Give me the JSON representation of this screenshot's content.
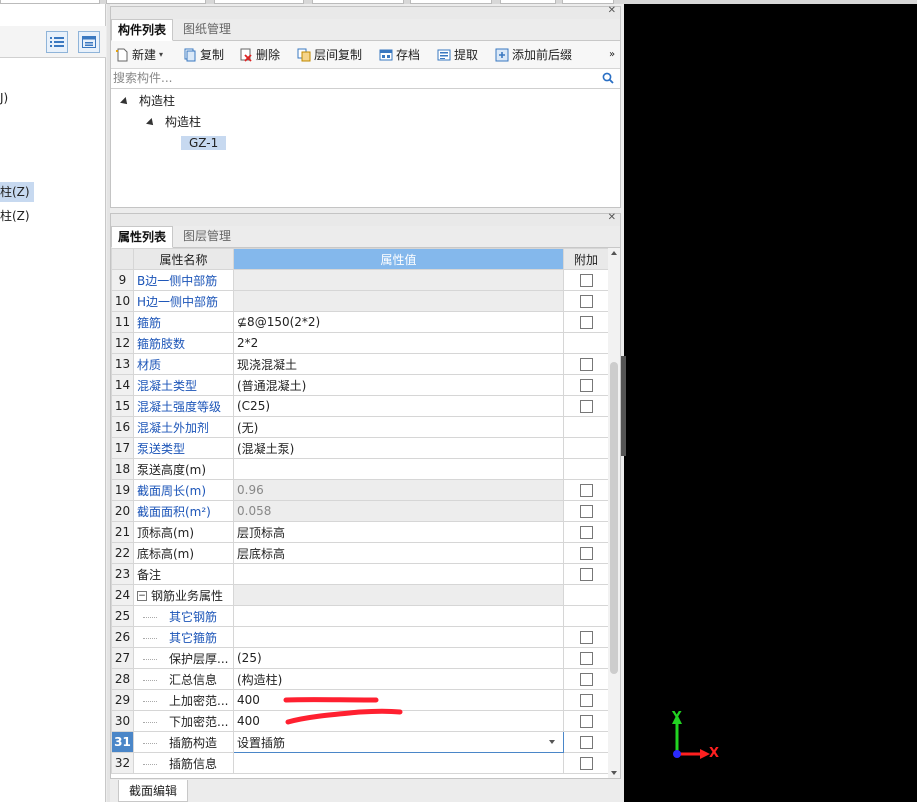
{
  "left": {
    "items": [
      {
        "label": "J)"
      },
      {
        "label": "柱(Z)"
      },
      {
        "label": "柱(Z)"
      }
    ]
  },
  "component_panel": {
    "tabs": [
      {
        "label": "构件列表"
      },
      {
        "label": "图纸管理"
      }
    ],
    "toolbar": {
      "new": "新建",
      "copy": "复制",
      "delete": "删除",
      "floor_copy": "层间复制",
      "save": "存档",
      "extract": "提取",
      "add_prefix": "添加前后缀",
      "more": "»"
    },
    "search": {
      "placeholder": "搜索构件..."
    },
    "tree": {
      "root": "构造柱",
      "child": "构造柱",
      "leaf": "GZ-1"
    }
  },
  "property_panel": {
    "tabs": [
      {
        "label": "属性列表"
      },
      {
        "label": "图层管理"
      }
    ],
    "headers": {
      "name": "属性名称",
      "value": "属性值",
      "add": "附加"
    },
    "rows": [
      {
        "num": "9",
        "name": "B边一侧中部筋",
        "value": ""
      },
      {
        "num": "10",
        "name": "H边一侧中部筋",
        "value": ""
      },
      {
        "num": "11",
        "name": "箍筋",
        "value": "⊈8@150(2*2)"
      },
      {
        "num": "12",
        "name": "箍筋肢数",
        "value": "2*2"
      },
      {
        "num": "13",
        "name": "材质",
        "value": "现浇混凝土"
      },
      {
        "num": "14",
        "name": "混凝土类型",
        "value": "(普通混凝土)"
      },
      {
        "num": "15",
        "name": "混凝土强度等级",
        "value": "(C25)"
      },
      {
        "num": "16",
        "name": "混凝土外加剂",
        "value": "(无)"
      },
      {
        "num": "17",
        "name": "泵送类型",
        "value": "(混凝土泵)"
      },
      {
        "num": "18",
        "name": "泵送高度(m)",
        "value": ""
      },
      {
        "num": "19",
        "name": "截面周长(m)",
        "value": "0.96"
      },
      {
        "num": "20",
        "name": "截面面积(m²)",
        "value": "0.058"
      },
      {
        "num": "21",
        "name": "顶标高(m)",
        "value": "层顶标高"
      },
      {
        "num": "22",
        "name": "底标高(m)",
        "value": "层底标高"
      },
      {
        "num": "23",
        "name": "备注",
        "value": ""
      },
      {
        "num": "24",
        "name": "钢筋业务属性",
        "value": ""
      },
      {
        "num": "25",
        "name": "其它钢筋",
        "value": ""
      },
      {
        "num": "26",
        "name": "其它箍筋",
        "value": ""
      },
      {
        "num": "27",
        "name": "保护层厚...",
        "value": "(25)"
      },
      {
        "num": "28",
        "name": "汇总信息",
        "value": "(构造柱)"
      },
      {
        "num": "29",
        "name": "上加密范...",
        "value": "400"
      },
      {
        "num": "30",
        "name": "下加密范...",
        "value": "400"
      },
      {
        "num": "31",
        "name": "插筋构造",
        "value": "设置插筋"
      },
      {
        "num": "32",
        "name": "插筋信息",
        "value": ""
      }
    ]
  },
  "bottom_tab": {
    "label": "截面编辑"
  },
  "viewport": {
    "axis_x": "X",
    "axis_y": "Y",
    "colors": {
      "x": "#ff2020",
      "y": "#22d322",
      "z": "#2a2aff"
    }
  }
}
